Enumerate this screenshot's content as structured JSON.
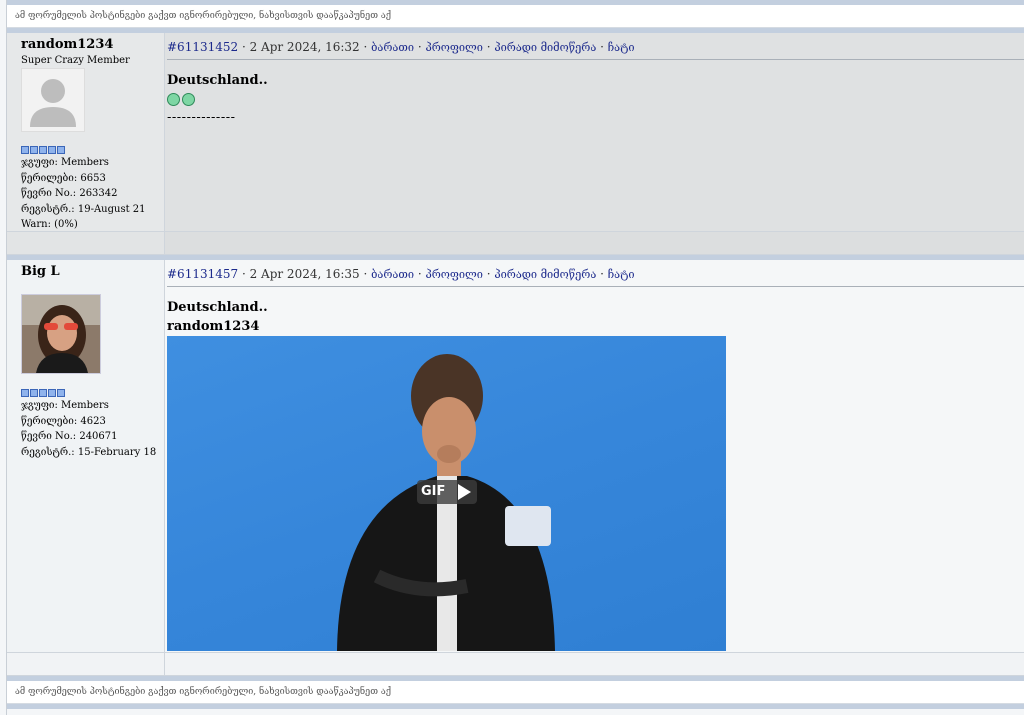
{
  "notice": {
    "text": "ამ ფორუმელის პოსტინგები გაქვთ იგნორირებული, ნახვისთვის დააწკაპუნეთ აქ"
  },
  "posts": [
    {
      "username": "random1234",
      "user_title": "Super Crazy Member",
      "avatar_icon": "default-avatar-icon",
      "rank_pips": 5,
      "stats": {
        "group": "ჯგუფი: Members",
        "posts": "წერილები: 6653",
        "member_no": "წევრი No.: 263342",
        "registered": "რეგისტრ.: 19-August 21",
        "warn": "Warn: (0%)"
      },
      "post_id": "#61131452",
      "datetime": " · 2 Apr 2024, 16:32 · ",
      "links": [
        "ბარათი",
        "პროფილი",
        "პირადი მიმოწერა",
        "ჩატი"
      ],
      "content_bold": "Deutschland..",
      "smilies": [
        "smiley-icon",
        "smiley-icon"
      ],
      "signature_line": "--------------"
    },
    {
      "username": "Big L",
      "user_title": "",
      "rank_pips": 5,
      "stats": {
        "group": "ჯგუფი: Members",
        "posts": "წერილები: 4623",
        "member_no": "წევრი No.: 240671",
        "registered": "რეგისტრ.: 15-February 18"
      },
      "post_id": "#61131457",
      "datetime": " · 2 Apr 2024, 16:35 · ",
      "links": [
        "ბარათი",
        "პროფილი",
        "პირადი მიმოწერა",
        "ჩატი"
      ],
      "content_bold": "Deutschland..",
      "quote_author": "random1234",
      "gif_badge": "GIF"
    }
  ],
  "colors": {
    "link": "#1c2a8c",
    "separator": "#c3cfdf",
    "gif_bg": "#3686da"
  }
}
